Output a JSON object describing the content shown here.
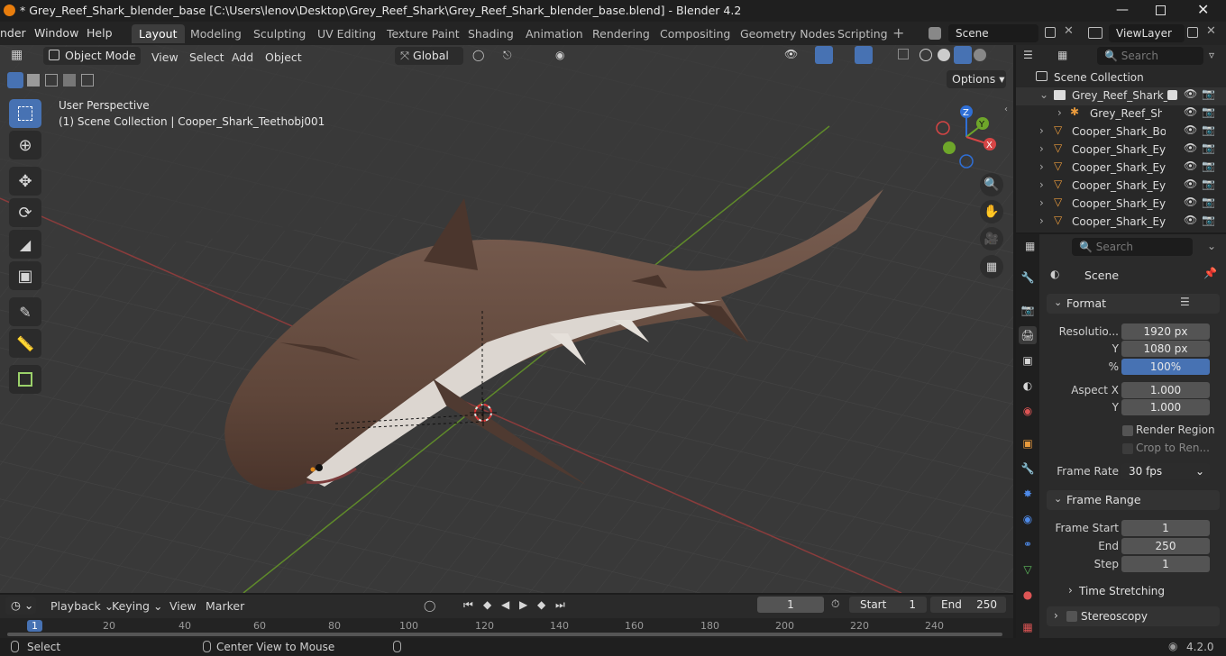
{
  "title": "* Grey_Reef_Shark_blender_base [C:\\Users\\lenov\\Desktop\\Grey_Reef_Shark\\Grey_Reef_Shark_blender_base.blend] - Blender 4.2",
  "menus": [
    "nder",
    "Window",
    "Help"
  ],
  "workspaces": [
    "Layout",
    "Modeling",
    "Sculpting",
    "UV Editing",
    "Texture Paint",
    "Shading",
    "Animation",
    "Rendering",
    "Compositing",
    "Geometry Nodes",
    "Scripting"
  ],
  "active_workspace": "Layout",
  "scene_name": "Scene",
  "view_layer": "ViewLayer",
  "viewport": {
    "mode": "Object Mode",
    "menus": [
      "View",
      "Select",
      "Add",
      "Object"
    ],
    "orientation": "Global",
    "options_label": "Options",
    "info_line1": "User Perspective",
    "info_line2": "(1) Scene Collection | Cooper_Shark_Teethobj001",
    "gizmo": {
      "x": "X",
      "y": "Y",
      "z": "Z"
    }
  },
  "outliner": {
    "search_placeholder": "Search",
    "root": "Scene Collection",
    "items": [
      {
        "name": "Grey_Reef_Shark_la",
        "icon": "collection-icon"
      },
      {
        "name": "Grey_Reef_Shar",
        "icon": "armature-icon"
      },
      {
        "name": "Cooper_Shark_Bod",
        "icon": "mesh-icon"
      },
      {
        "name": "Cooper_Shark_Eye",
        "icon": "mesh-icon"
      },
      {
        "name": "Cooper_Shark_Eye",
        "icon": "mesh-icon"
      },
      {
        "name": "Cooper_Shark_Eye",
        "icon": "mesh-icon"
      },
      {
        "name": "Cooper_Shark_Eye",
        "icon": "mesh-icon"
      },
      {
        "name": "Cooper_Shark_Eye",
        "icon": "mesh-icon"
      }
    ]
  },
  "properties": {
    "search_placeholder": "Search",
    "context": "Scene",
    "format_header": "Format",
    "resolution_x_label": "Resolutio...",
    "resolution_x": "1920 px",
    "resolution_y_label": "Y",
    "resolution_y": "1080 px",
    "percent_label": "%",
    "percent": "100%",
    "aspect_x_label": "Aspect X",
    "aspect_x": "1.000",
    "aspect_y_label": "Y",
    "aspect_y": "1.000",
    "render_region": "Render Region",
    "crop": "Crop to Ren...",
    "frame_rate_label": "Frame Rate",
    "frame_rate": "30 fps",
    "frame_range_header": "Frame Range",
    "frame_start_label": "Frame Start",
    "frame_start": "1",
    "end_label": "End",
    "end": "250",
    "step_label": "Step",
    "step": "1",
    "time_stretching": "Time Stretching",
    "stereoscopy": "Stereoscopy"
  },
  "timeline": {
    "menus": [
      "Playback",
      "Keying",
      "View",
      "Marker"
    ],
    "current_frame": "1",
    "start_label": "Start",
    "start": "1",
    "end_label": "End",
    "end": "250",
    "ticks": [
      "1",
      "20",
      "40",
      "60",
      "80",
      "100",
      "120",
      "140",
      "160",
      "180",
      "200",
      "220",
      "240"
    ]
  },
  "status": {
    "select": "Select",
    "center_view": "Center View to Mouse",
    "version": "4.2.0"
  },
  "colors": {
    "accent": "#4772b3",
    "viewport_bg": "#393939",
    "x_axis": "#c24444",
    "y_axis": "#6a9a2a"
  }
}
